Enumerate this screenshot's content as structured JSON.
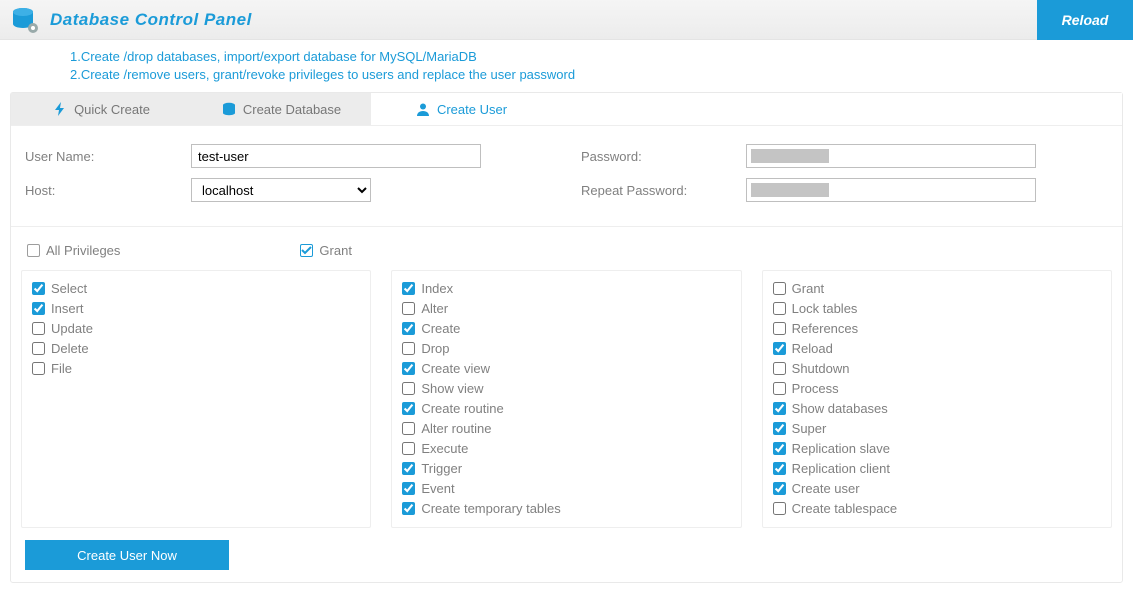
{
  "header": {
    "title": "Database Control Panel",
    "reload": "Reload"
  },
  "desc": {
    "line1": "1.Create /drop databases, import/export database for MySQL/MariaDB",
    "line2": "2.Create /remove users, grant/revoke privileges to users and replace the user password"
  },
  "tabs": {
    "quick": "Quick Create",
    "createdb": "Create Database",
    "createuser": "Create User",
    "active": 2
  },
  "form": {
    "username_label": "User Name:",
    "username_value": "test-user",
    "host_label": "Host:",
    "host_value": "localhost",
    "host_options": [
      "localhost"
    ],
    "password_label": "Password:",
    "password_value": "",
    "repeat_label": "Repeat Password:",
    "repeat_value": ""
  },
  "priv_top": {
    "all": {
      "label": "All Privileges",
      "checked": false
    },
    "grant": {
      "label": "Grant",
      "checked": true
    }
  },
  "priv_cols": [
    [
      {
        "label": "Select",
        "checked": true
      },
      {
        "label": "Insert",
        "checked": true
      },
      {
        "label": "Update",
        "checked": false
      },
      {
        "label": "Delete",
        "checked": false
      },
      {
        "label": "File",
        "checked": false
      }
    ],
    [
      {
        "label": "Index",
        "checked": true
      },
      {
        "label": "Alter",
        "checked": false
      },
      {
        "label": "Create",
        "checked": true
      },
      {
        "label": "Drop",
        "checked": false
      },
      {
        "label": "Create view",
        "checked": true
      },
      {
        "label": "Show view",
        "checked": false
      },
      {
        "label": "Create routine",
        "checked": true
      },
      {
        "label": "Alter routine",
        "checked": false
      },
      {
        "label": "Execute",
        "checked": false
      },
      {
        "label": "Trigger",
        "checked": true
      },
      {
        "label": "Event",
        "checked": true
      },
      {
        "label": "Create temporary tables",
        "checked": true
      }
    ],
    [
      {
        "label": "Grant",
        "checked": false
      },
      {
        "label": "Lock tables",
        "checked": false
      },
      {
        "label": "References",
        "checked": false
      },
      {
        "label": "Reload",
        "checked": true
      },
      {
        "label": "Shutdown",
        "checked": false
      },
      {
        "label": "Process",
        "checked": false
      },
      {
        "label": "Show databases",
        "checked": true
      },
      {
        "label": "Super",
        "checked": true
      },
      {
        "label": "Replication slave",
        "checked": true
      },
      {
        "label": "Replication client",
        "checked": true
      },
      {
        "label": "Create user",
        "checked": true
      },
      {
        "label": "Create tablespace",
        "checked": false
      }
    ]
  ],
  "create_btn": "Create User Now"
}
